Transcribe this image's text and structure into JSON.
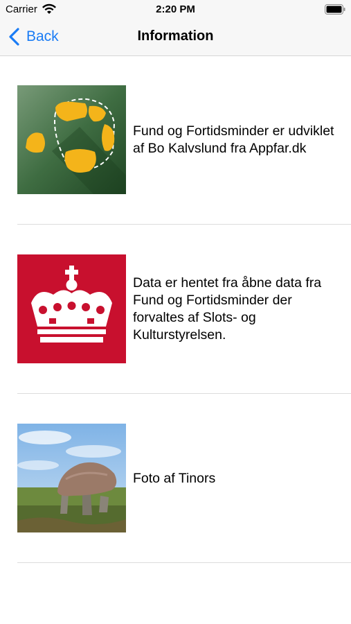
{
  "status_bar": {
    "carrier": "Carrier",
    "time": "2:20 PM",
    "icons": [
      "wifi-icon",
      "battery-icon"
    ]
  },
  "nav": {
    "back_label": "Back",
    "title": "Information",
    "accent_color": "#1a7cf5"
  },
  "items": [
    {
      "image": "app-logo-image",
      "text": "Fund og Fortidsminder er udviklet af Bo Kalvslund fra Appfar.dk"
    },
    {
      "image": "crown-logo-image",
      "text": "Data er hentet fra åbne data fra Fund og Fortidsminder der forvaltes af Slots- og Kulturstyrelsen."
    },
    {
      "image": "dolmen-photo",
      "text": "Foto af Tinors"
    }
  ]
}
